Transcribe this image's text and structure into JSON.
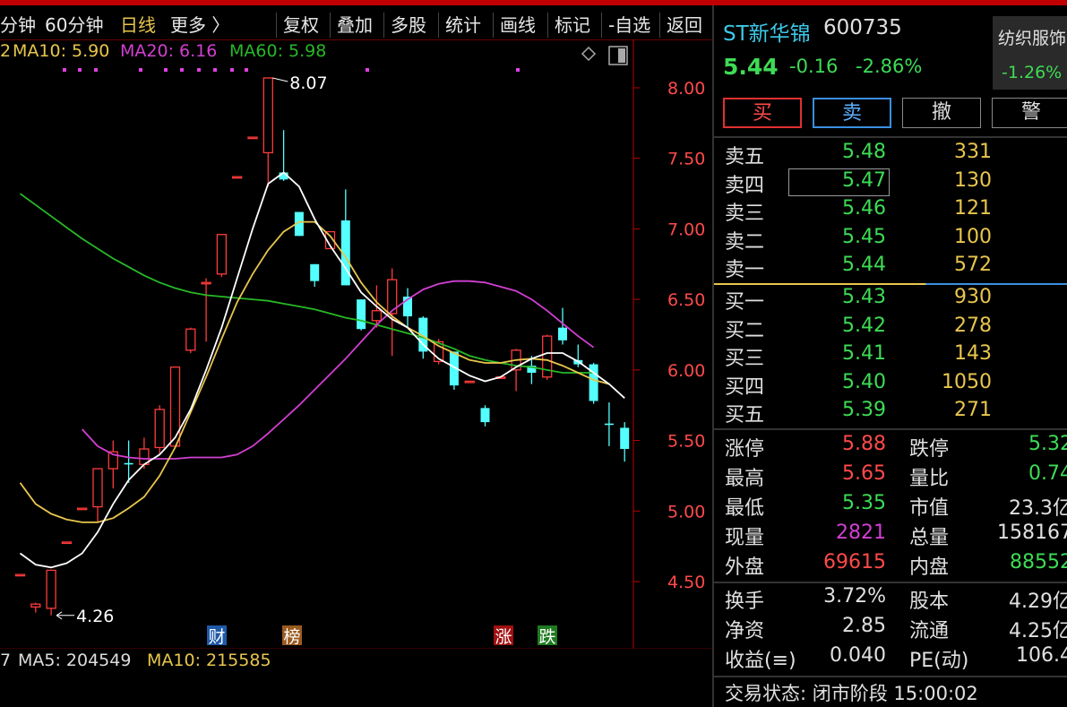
{
  "toolbar": {
    "left_items": [
      {
        "label": "分钟",
        "active": false
      },
      {
        "label": "60分钟",
        "active": false
      },
      {
        "label": "日线",
        "active": true
      },
      {
        "label": "更多 〉",
        "active": false
      }
    ],
    "right_items": [
      "复权",
      "叠加",
      "多股",
      "统计",
      "画线",
      "标记",
      "-自选",
      "返回"
    ]
  },
  "ma_legend": {
    "cut": "2",
    "ma10": "MA10: 5.90",
    "ma20": "MA20: 6.16",
    "ma60": "MA60: 5.98"
  },
  "colors": {
    "up": "#ff3b3b",
    "down": "#54ffff",
    "ma5": "#ffffff",
    "ma10": "#e8c64d",
    "ma20": "#d23fd2",
    "ma60": "#27b827",
    "axis": "#c00000",
    "green": "#3ddc55"
  },
  "chart_data": {
    "type": "candlestick",
    "y_ticks": [
      "8.00",
      "7.50",
      "7.00",
      "6.50",
      "6.00",
      "5.50",
      "5.00",
      "4.50"
    ],
    "ylim": [
      4.3,
      8.15
    ],
    "high_label": "8.07",
    "low_label": "4.26",
    "candles": [
      {
        "i": 0,
        "o": 4.55,
        "c": 4.55,
        "h": 4.55,
        "l": 4.55
      },
      {
        "i": 1,
        "o": 4.32,
        "c": 4.34,
        "h": 4.35,
        "l": 4.28
      },
      {
        "i": 2,
        "o": 4.31,
        "c": 4.58,
        "h": 4.58,
        "l": 4.26
      },
      {
        "i": 3,
        "o": 4.78,
        "c": 4.78,
        "h": 4.78,
        "l": 4.78
      },
      {
        "i": 4,
        "o": 5.02,
        "c": 5.02,
        "h": 5.02,
        "l": 5.02
      },
      {
        "i": 5,
        "o": 5.03,
        "c": 5.3,
        "h": 5.3,
        "l": 4.92
      },
      {
        "i": 6,
        "o": 5.3,
        "c": 5.42,
        "h": 5.5,
        "l": 5.16
      },
      {
        "i": 7,
        "o": 5.34,
        "c": 5.33,
        "h": 5.5,
        "l": 5.2
      },
      {
        "i": 8,
        "o": 5.33,
        "c": 5.44,
        "h": 5.52,
        "l": 5.3
      },
      {
        "i": 9,
        "o": 5.45,
        "c": 5.72,
        "h": 5.75,
        "l": 5.4
      },
      {
        "i": 10,
        "o": 5.46,
        "c": 6.02,
        "h": 6.02,
        "l": 5.45
      },
      {
        "i": 11,
        "o": 6.14,
        "c": 6.29,
        "h": 6.3,
        "l": 6.12
      },
      {
        "i": 12,
        "o": 6.62,
        "c": 6.62,
        "h": 6.65,
        "l": 6.2
      },
      {
        "i": 13,
        "o": 6.68,
        "c": 6.96,
        "h": 6.96,
        "l": 6.66
      },
      {
        "i": 14,
        "o": 7.37,
        "c": 7.37,
        "h": 7.37,
        "l": 7.37
      },
      {
        "i": 15,
        "o": 7.65,
        "c": 7.65,
        "h": 7.65,
        "l": 7.65
      },
      {
        "i": 16,
        "o": 7.54,
        "c": 8.07,
        "h": 8.07,
        "l": 7.3
      },
      {
        "i": 17,
        "o": 7.4,
        "c": 7.35,
        "h": 7.7,
        "l": 7.34
      },
      {
        "i": 18,
        "o": 7.12,
        "c": 6.95,
        "h": 7.12,
        "l": 6.95
      },
      {
        "i": 19,
        "o": 6.75,
        "c": 6.63,
        "h": 6.75,
        "l": 6.59
      },
      {
        "i": 20,
        "o": 6.86,
        "c": 6.98,
        "h": 6.98,
        "l": 6.86
      },
      {
        "i": 21,
        "o": 7.06,
        "c": 6.6,
        "h": 7.28,
        "l": 6.6
      },
      {
        "i": 22,
        "o": 6.5,
        "c": 6.29,
        "h": 6.5,
        "l": 6.28
      },
      {
        "i": 23,
        "o": 6.35,
        "c": 6.42,
        "h": 6.6,
        "l": 6.3
      },
      {
        "i": 24,
        "o": 6.4,
        "c": 6.64,
        "h": 6.72,
        "l": 6.1
      },
      {
        "i": 25,
        "o": 6.52,
        "c": 6.38,
        "h": 6.58,
        "l": 6.3
      },
      {
        "i": 26,
        "o": 6.37,
        "c": 6.13,
        "h": 6.38,
        "l": 6.08
      },
      {
        "i": 27,
        "o": 6.06,
        "c": 6.2,
        "h": 6.22,
        "l": 6.04
      },
      {
        "i": 28,
        "o": 6.13,
        "c": 5.89,
        "h": 6.13,
        "l": 5.86
      },
      {
        "i": 29,
        "o": 5.92,
        "c": 5.92,
        "h": 5.92,
        "l": 5.92
      },
      {
        "i": 30,
        "o": 5.73,
        "c": 5.63,
        "h": 5.75,
        "l": 5.6
      },
      {
        "i": 31,
        "o": 5.95,
        "c": 5.95,
        "h": 5.95,
        "l": 5.95
      },
      {
        "i": 32,
        "o": 6.0,
        "c": 6.14,
        "h": 6.15,
        "l": 5.85
      },
      {
        "i": 33,
        "o": 6.03,
        "c": 5.98,
        "h": 6.1,
        "l": 5.9
      },
      {
        "i": 34,
        "o": 5.95,
        "c": 6.24,
        "h": 6.25,
        "l": 5.93
      },
      {
        "i": 35,
        "o": 6.3,
        "c": 6.21,
        "h": 6.44,
        "l": 6.18
      },
      {
        "i": 36,
        "o": 6.07,
        "c": 6.04,
        "h": 6.18,
        "l": 6.02
      },
      {
        "i": 37,
        "o": 6.04,
        "c": 5.78,
        "h": 6.05,
        "l": 5.76
      },
      {
        "i": 38,
        "o": 5.62,
        "c": 5.61,
        "h": 5.77,
        "l": 5.46
      },
      {
        "i": 39,
        "o": 5.59,
        "c": 5.44,
        "h": 5.63,
        "l": 5.35
      }
    ],
    "ma5": [
      4.7,
      4.62,
      4.6,
      4.63,
      4.7,
      4.85,
      5.05,
      5.22,
      5.33,
      5.4,
      5.52,
      5.72,
      6.0,
      6.3,
      6.65,
      7.0,
      7.32,
      7.4,
      7.3,
      7.07,
      6.88,
      6.72,
      6.55,
      6.45,
      6.36,
      6.3,
      6.18,
      6.08,
      6.02,
      5.96,
      5.92,
      5.95,
      6.02,
      6.08,
      6.12,
      6.12,
      6.06,
      5.98,
      5.9,
      5.8
    ],
    "ma10": [
      5.2,
      5.05,
      4.98,
      4.94,
      4.92,
      4.92,
      4.95,
      5.02,
      5.1,
      5.25,
      5.45,
      5.7,
      5.95,
      6.22,
      6.48,
      6.68,
      6.85,
      6.98,
      7.05,
      7.05,
      6.95,
      6.8,
      6.62,
      6.48,
      6.38,
      6.3,
      6.24,
      6.17,
      6.12,
      6.07,
      6.05,
      6.05,
      6.07,
      6.08,
      6.07,
      6.03,
      5.98,
      5.93,
      5.9
    ],
    "ma20": [
      5.58,
      5.46,
      5.4,
      5.38,
      5.37,
      5.37,
      5.37,
      5.38,
      5.38,
      5.38,
      5.4,
      5.46,
      5.55,
      5.65,
      5.75,
      5.86,
      5.97,
      6.08,
      6.2,
      6.32,
      6.42,
      6.5,
      6.57,
      6.61,
      6.63,
      6.63,
      6.62,
      6.59,
      6.56,
      6.5,
      6.42,
      6.33,
      6.24,
      6.16
    ],
    "ma60": [
      7.25,
      7.17,
      7.09,
      7.01,
      6.93,
      6.86,
      6.79,
      6.73,
      6.67,
      6.62,
      6.58,
      6.55,
      6.53,
      6.52,
      6.51,
      6.5,
      6.49,
      6.47,
      6.45,
      6.43,
      6.4,
      6.37,
      6.35,
      6.32,
      6.29,
      6.26,
      6.23,
      6.19,
      6.15,
      6.1,
      6.07,
      6.05,
      6.03,
      6.02,
      6.0,
      5.98,
      5.98,
      5.98
    ],
    "markers": [
      {
        "text": "财",
        "color": "#1f5aa8"
      },
      {
        "text": "榜",
        "color": "#9a5a1f"
      },
      {
        "text": "涨",
        "color": "#a01010"
      },
      {
        "text": "跌",
        "color": "#1f7a1f"
      }
    ]
  },
  "vol_legend": {
    "cut": "7",
    "ma5": "MA5: 204549",
    "ma10": "MA10: 215585"
  },
  "quote": {
    "name": "ST新华锦",
    "code": "600735",
    "price": "5.44",
    "change": "-0.16",
    "change_pct": "-2.86%",
    "sector_name": "纺织服饰",
    "sector_pct": "-1.26%"
  },
  "buttons": [
    "买",
    "卖",
    "撤",
    "警"
  ],
  "asks": [
    {
      "label": "卖五",
      "price": "5.48",
      "vol": "331"
    },
    {
      "label": "卖四",
      "price": "5.47",
      "vol": "130"
    },
    {
      "label": "卖三",
      "price": "5.46",
      "vol": "121"
    },
    {
      "label": "卖二",
      "price": "5.45",
      "vol": "100"
    },
    {
      "label": "卖一",
      "price": "5.44",
      "vol": "572"
    }
  ],
  "bids": [
    {
      "label": "买一",
      "price": "5.43",
      "vol": "930"
    },
    {
      "label": "买二",
      "price": "5.42",
      "vol": "278"
    },
    {
      "label": "买三",
      "price": "5.41",
      "vol": "143"
    },
    {
      "label": "买四",
      "price": "5.40",
      "vol": "1050"
    },
    {
      "label": "买五",
      "price": "5.39",
      "vol": "271"
    }
  ],
  "stats": [
    [
      {
        "l": "涨停",
        "v": "5.88",
        "c": "red"
      },
      {
        "l": "跌停",
        "v": "5.32",
        "c": "green"
      }
    ],
    [
      {
        "l": "最高",
        "v": "5.65",
        "c": "red"
      },
      {
        "l": "量比",
        "v": "0.74",
        "c": "green"
      }
    ],
    [
      {
        "l": "最低",
        "v": "5.35",
        "c": "green"
      },
      {
        "l": "市值",
        "v": "23.3亿",
        "c": "white"
      }
    ],
    [
      {
        "l": "现量",
        "v": "2821",
        "c": "purple"
      },
      {
        "l": "总量",
        "v": "158167",
        "c": "white"
      }
    ],
    [
      {
        "l": "外盘",
        "v": "69615",
        "c": "red"
      },
      {
        "l": "内盘",
        "v": "88552",
        "c": "green"
      }
    ]
  ],
  "fin": [
    [
      {
        "l": "换手",
        "v": "3.72%"
      },
      {
        "l": "股本",
        "v": "4.29亿"
      }
    ],
    [
      {
        "l": "净资",
        "v": "2.85"
      },
      {
        "l": "流通",
        "v": "4.25亿"
      }
    ],
    [
      {
        "l": "收益(≡)",
        "v": "0.040"
      },
      {
        "l": "PE(动)",
        "v": "106.4"
      }
    ]
  ],
  "status": "交易状态: 闭市阶段 15:00:02"
}
